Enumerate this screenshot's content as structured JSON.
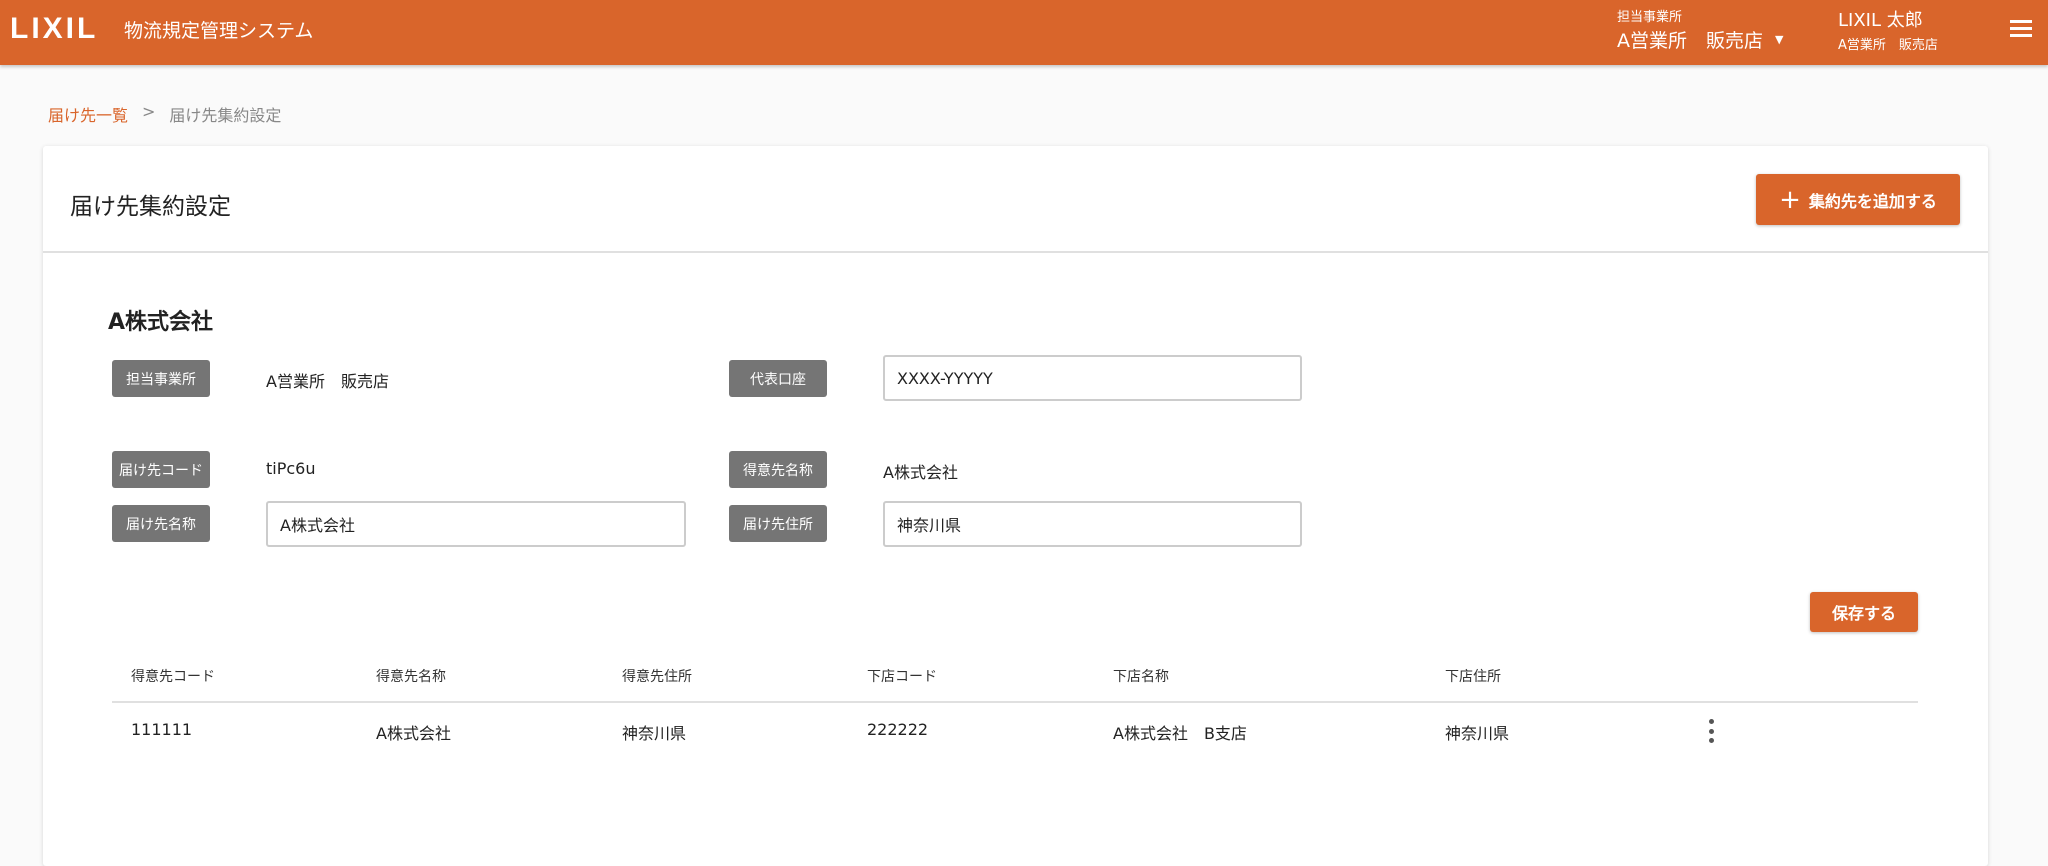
{
  "header": {
    "logo": "LIXIL",
    "app_title": "物流規定管理システム",
    "office_label": "担当事業所",
    "office_value": "A営業所　販売店",
    "user_name": "LIXIL 太郎",
    "user_office": "A営業所　販売店"
  },
  "breadcrumb": {
    "parent": "届け先一覧",
    "separator": ">",
    "current": "届け先集約設定"
  },
  "card": {
    "title": "届け先集約設定",
    "add_button": "集約先を追加する"
  },
  "company": {
    "name": "A株式会社",
    "fields": {
      "office_label": "担当事業所",
      "office_value": "A営業所　販売店",
      "account_label": "代表口座",
      "account_value": "XXXX-YYYYY",
      "dest_code_label": "届け先コード",
      "dest_code_value": "tiPc6u",
      "customer_name_label": "得意先名称",
      "customer_name_value": "A株式会社",
      "dest_name_label": "届け先名称",
      "dest_name_value": "A株式会社",
      "dest_address_label": "届け先住所",
      "dest_address_value": "神奈川県"
    },
    "save_button": "保存する"
  },
  "table": {
    "headers": [
      "得意先コード",
      "得意先名称",
      "得意先住所",
      "下店コード",
      "下店名称",
      "下店住所"
    ],
    "rows": [
      [
        "111111",
        "A株式会社",
        "神奈川県",
        "222222",
        "A株式会社　B支店",
        "神奈川県"
      ]
    ]
  }
}
